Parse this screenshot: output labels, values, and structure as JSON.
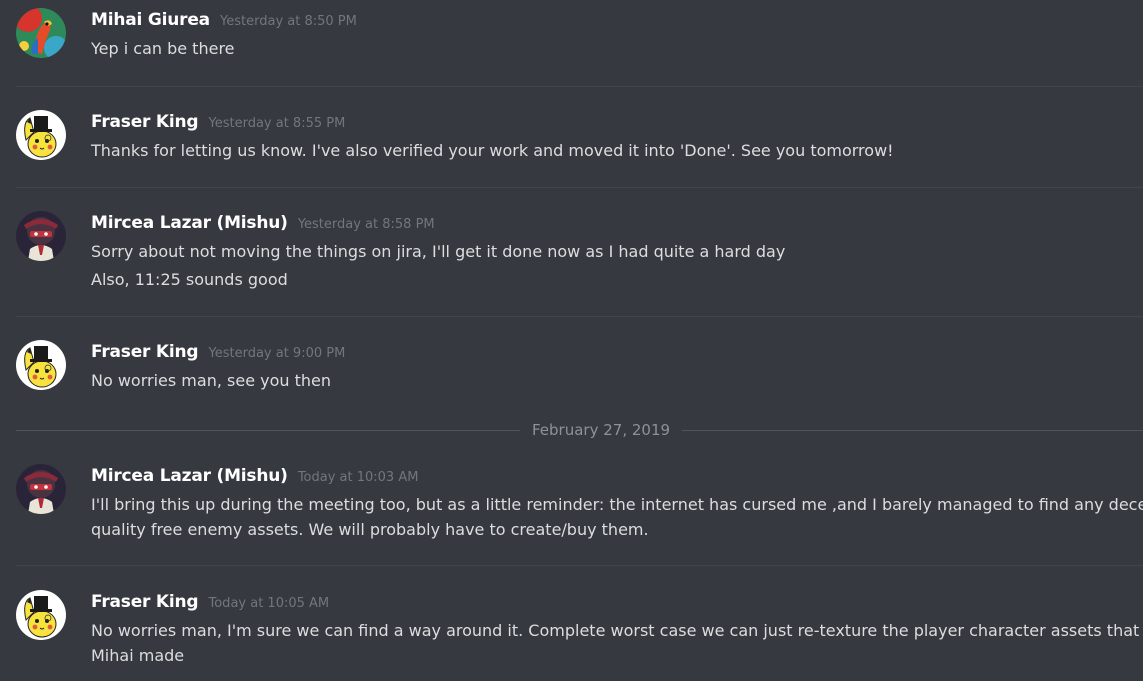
{
  "date_divider": "February 27, 2019",
  "messages": [
    {
      "author": "Mihai Giurea",
      "timestamp": "Yesterday at 8:50 PM",
      "avatar_icon": "parrot-avatar-icon",
      "lines": [
        "Yep i can be there"
      ]
    },
    {
      "author": "Fraser King",
      "timestamp": "Yesterday at 8:55 PM",
      "avatar_icon": "pikachu-tophat-avatar-icon",
      "lines": [
        "Thanks for letting us know. I've also verified your work and moved it into 'Done'. See you tomorrow!"
      ]
    },
    {
      "author": "Mircea Lazar (Mishu)",
      "timestamp": "Yesterday at 8:58 PM",
      "avatar_icon": "masked-character-avatar-icon",
      "lines": [
        "Sorry about not moving the things on jira, I'll get it done now as I had quite a hard day",
        "Also, 11:25 sounds good"
      ]
    },
    {
      "author": "Fraser King",
      "timestamp": "Yesterday at 9:00 PM",
      "avatar_icon": "pikachu-tophat-avatar-icon",
      "lines": [
        "No worries man, see you then"
      ]
    },
    {
      "author": "Mircea Lazar (Mishu)",
      "timestamp": "Today at 10:03 AM",
      "avatar_icon": "masked-character-avatar-icon",
      "lines": [
        "I'll bring this up during the meeting too, but as a little reminder: the internet has cursed me ,and I barely managed to find any decent",
        "quality free enemy assets. We will probably have to create/buy them."
      ]
    },
    {
      "author": "Fraser King",
      "timestamp": "Today at 10:05 AM",
      "avatar_icon": "pikachu-tophat-avatar-icon",
      "lines": [
        "No worries man, I'm sure we can find a way around it. Complete worst case we can just re-texture the player character assets that",
        "Mihai made"
      ]
    }
  ],
  "colors": {
    "background": "#36393f",
    "author": "#ffffff",
    "timestamp": "#72767d",
    "body_text": "#dcddde",
    "separator": "#41444a"
  }
}
